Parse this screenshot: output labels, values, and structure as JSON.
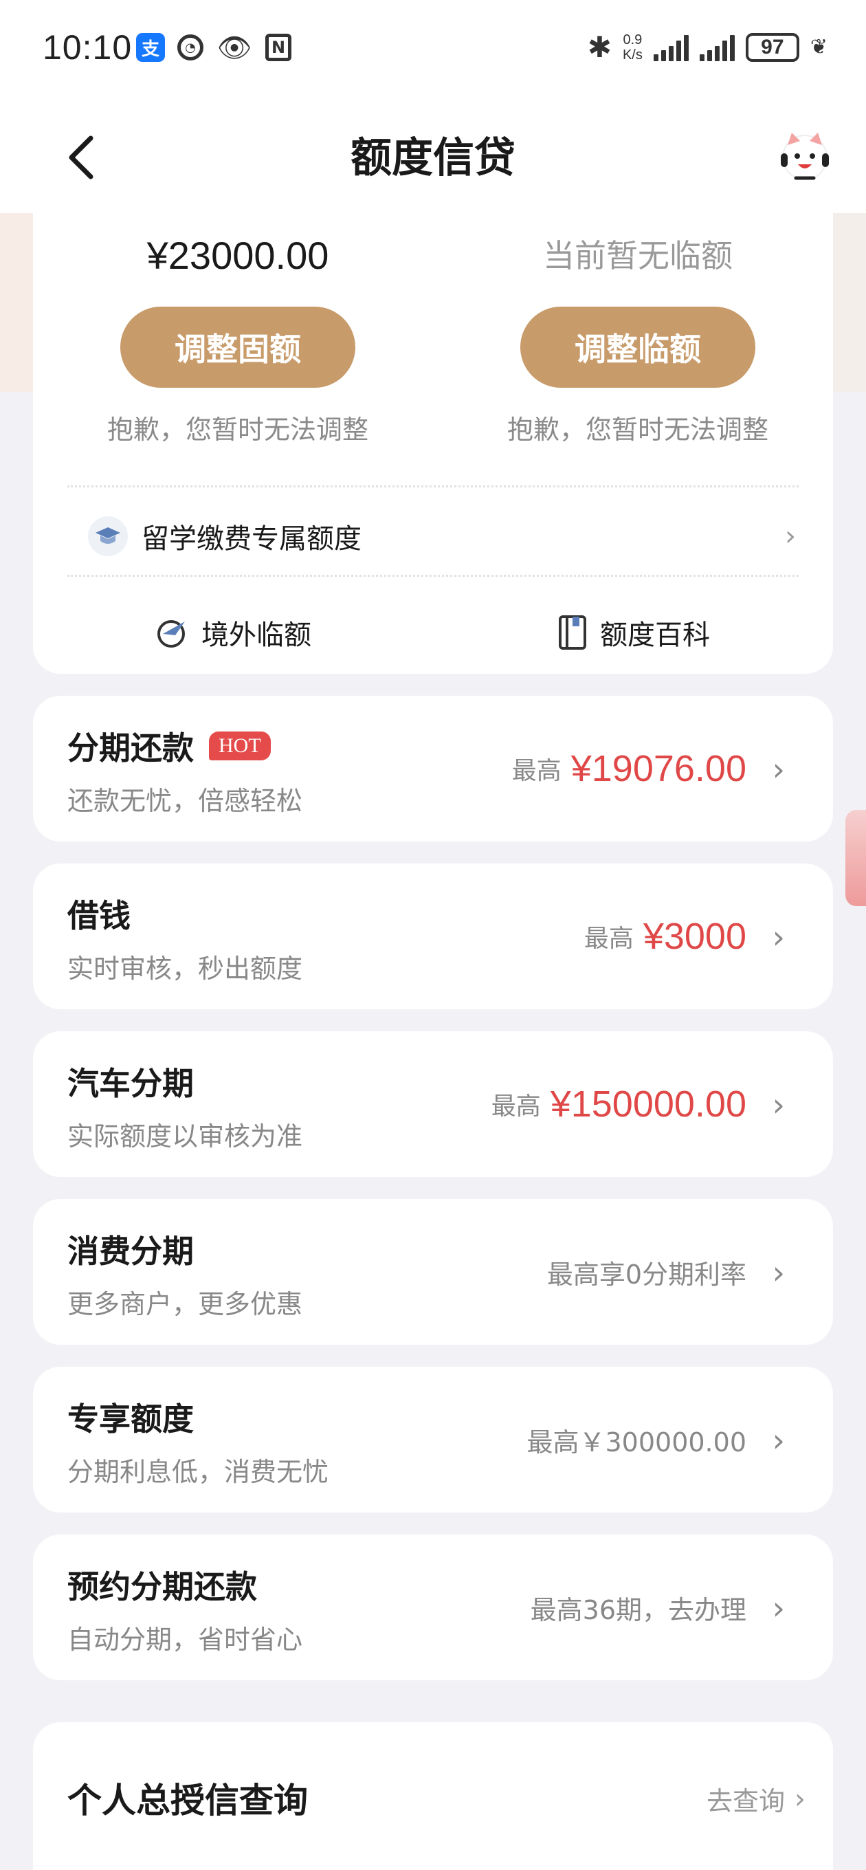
{
  "status_bar": {
    "time": "10:10",
    "net_speed_value": "0.9",
    "net_speed_unit": "K/s",
    "battery": "97",
    "alipay_icon_text": "支"
  },
  "navbar": {
    "title": "额度信贷"
  },
  "quota": {
    "fixed_amount": "¥23000.00",
    "temp_status": "当前暂无临额",
    "fixed_button": "调整固额",
    "temp_button": "调整临额",
    "fixed_note": "抱歉，您暂时无法调整",
    "temp_note": "抱歉，您暂时无法调整",
    "study_label": "留学缴费专属额度",
    "overseas_label": "境外临额",
    "wiki_label": "额度百科"
  },
  "products": [
    {
      "title": "分期还款",
      "badge": "HOT",
      "subtitle": "还款无忧，倍感轻松",
      "prefix": "最高",
      "value": "¥19076.00"
    },
    {
      "title": "借钱",
      "subtitle": "实时审核，秒出额度",
      "prefix": "最高",
      "value": "¥3000"
    },
    {
      "title": "汽车分期",
      "subtitle": "实际额度以审核为准",
      "prefix": "最高",
      "value": "¥150000.00"
    },
    {
      "title": "消费分期",
      "subtitle": "更多商户，更多优惠",
      "text": "最高享0分期利率"
    },
    {
      "title": "专享额度",
      "subtitle": "分期利息低，消费无忧",
      "text": "最高￥300000.00"
    },
    {
      "title": "预约分期还款",
      "subtitle": "自动分期，省时省心",
      "text": "最高36期，去办理"
    }
  ],
  "credit_query": {
    "title": "个人总授信查询",
    "action": "去查询"
  },
  "colors": {
    "accent_gold": "#c89b6a",
    "highlight_red": "#e04848",
    "hot_badge": "#e54b4b"
  }
}
